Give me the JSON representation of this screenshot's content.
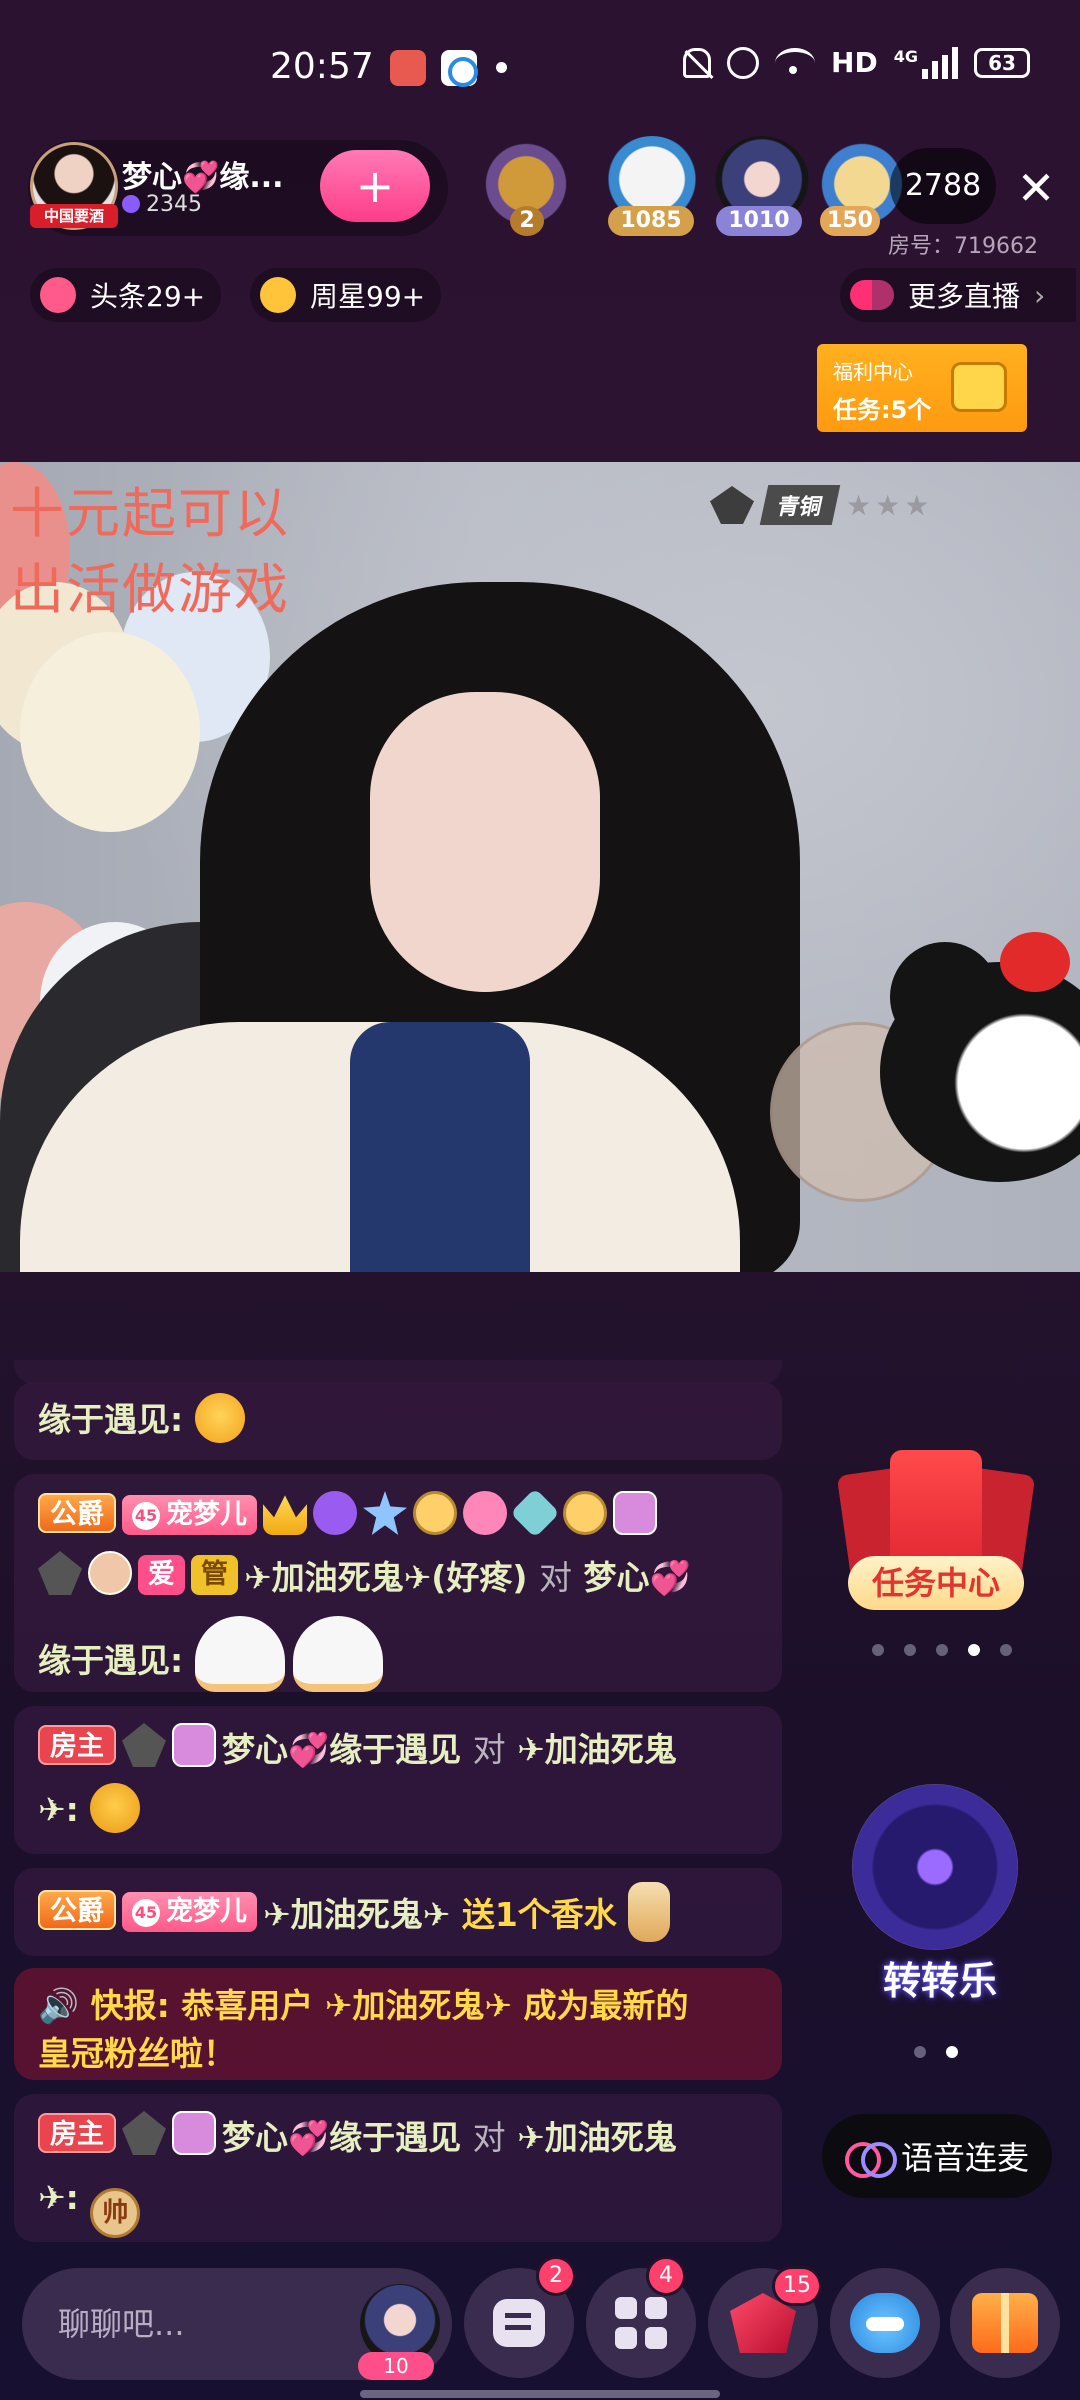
{
  "status_bar": {
    "time": "20:57",
    "network": "HD",
    "cellular": "4G",
    "battery": "63"
  },
  "host": {
    "name": "梦心💞缘...",
    "avatar_tag": "中国要酒",
    "fans": "2345",
    "follow_symbol": "+"
  },
  "viewers": {
    "ranks": [
      "2",
      "1085",
      "1010",
      "150"
    ],
    "count": "2788"
  },
  "room": {
    "number_text": "房号：719662",
    "close_symbol": "✕"
  },
  "chips": {
    "headline": "头条29+",
    "weekly_star": "周星99+",
    "more_live": "更多直播",
    "more_arrow": "›"
  },
  "welfare": {
    "title": "福利中心",
    "tasks": "任务:5个"
  },
  "video": {
    "overlay_line1": "十元起可以",
    "overlay_line2": "出活做游戏",
    "rank_label": "青铜",
    "rank_stars": "★★★"
  },
  "chat": {
    "msg1": {
      "name": "缘于遇见:"
    },
    "msg2": {
      "badge_duke": "公爵",
      "badge_pet_level": "45",
      "badge_pet": "宠梦儿",
      "badge_love": "爱",
      "badge_admin": "管",
      "sender": "✈加油死鬼✈(好疼)",
      "to": "对",
      "recipient": "梦心💞",
      "reply_name": "缘于遇见:"
    },
    "msg3": {
      "badge_host": "房主",
      "sender": "梦心💞缘于遇见",
      "to": "对",
      "recipient": "✈加油死鬼",
      "recipient_cont": "✈:"
    },
    "msg4": {
      "badge_duke": "公爵",
      "badge_pet_level": "45",
      "badge_pet": "宠梦儿",
      "sender": "✈加油死鬼✈",
      "gift_text": "送1个香水"
    },
    "msg5": {
      "text_line1": "🔊 快报: 恭喜用户 ✈加油死鬼✈ 成为最新的",
      "text_line2": "皇冠粉丝啦！"
    },
    "msg6": {
      "badge_host": "房主",
      "sender": "梦心💞缘于遇见",
      "to": "对",
      "recipient": "✈加油死鬼",
      "recipient_cont": "✈:",
      "emoji_text": "帅"
    }
  },
  "widgets": {
    "task_center": "任务中心",
    "wheel": "转转乐",
    "voice_link": "语音连麦"
  },
  "bottom_bar": {
    "input_placeholder": "聊聊吧...",
    "avatar_badge": "10",
    "messages_badge": "2",
    "apps_badge": "4",
    "gem_badge": "15"
  }
}
